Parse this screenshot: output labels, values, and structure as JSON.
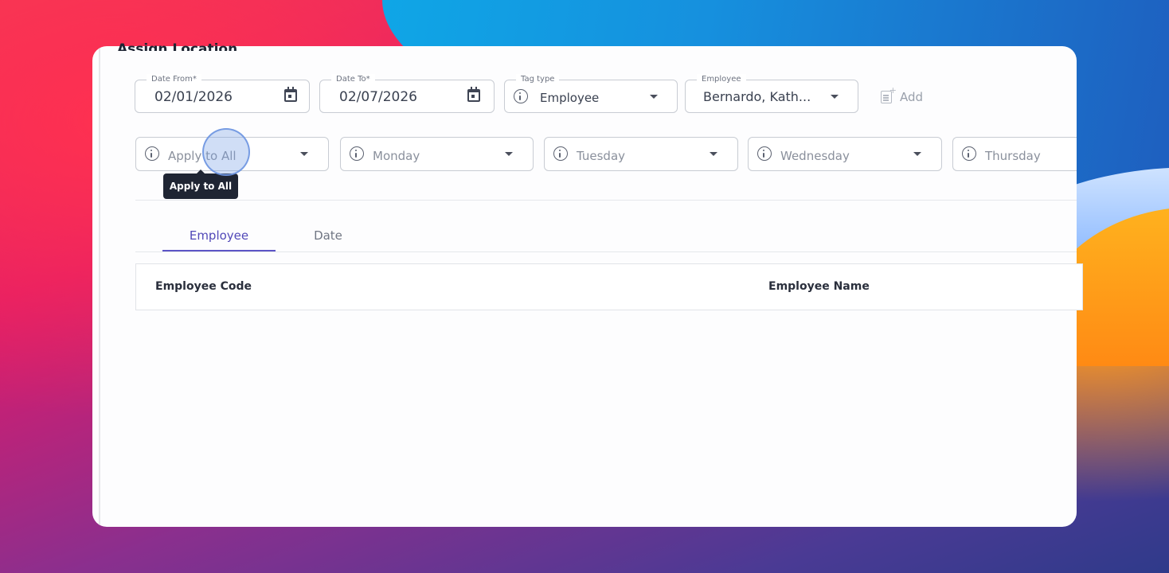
{
  "page": {
    "title": "Assign Location"
  },
  "filters": {
    "date_from": {
      "label": "Date From*",
      "value": "02/01/2026"
    },
    "date_to": {
      "label": "Date To*",
      "value": "02/07/2026"
    },
    "tag_type": {
      "label": "Tag type",
      "value": "Employee"
    },
    "employee": {
      "label": "Employee",
      "value": "Bernardo, Kath..."
    },
    "add_label": "Add"
  },
  "schedule": {
    "apply_all": "Apply to All",
    "days": [
      "Monday",
      "Tuesday",
      "Wednesday",
      "Thursday"
    ]
  },
  "tooltip": {
    "text": "Apply to All"
  },
  "tabs": [
    {
      "label": "Employee",
      "active": true
    },
    {
      "label": "Date",
      "active": false
    }
  ],
  "table": {
    "columns": [
      "Employee Code",
      "Employee Name"
    ]
  },
  "colors": {
    "accent": "#5b54c6",
    "tooltip_bg": "#1f2533"
  },
  "icons": [
    "calendar-icon",
    "info-icon",
    "chevron-down-icon",
    "add-note-icon"
  ]
}
